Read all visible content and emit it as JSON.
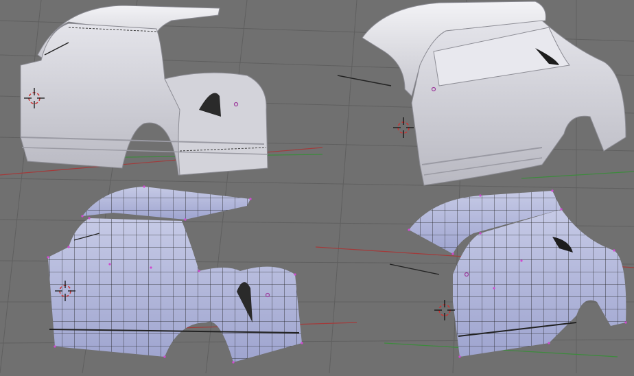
{
  "viewports": [
    {
      "id": "top-left",
      "view": "side-rear",
      "shading": "solid"
    },
    {
      "id": "top-right",
      "view": "front-three-quarter",
      "shading": "solid"
    },
    {
      "id": "bottom-left",
      "view": "side-rear",
      "shading": "wireframe-on-solid"
    },
    {
      "id": "bottom-right",
      "view": "front-three-quarter",
      "shading": "wireframe-on-solid"
    }
  ],
  "colors": {
    "background": "#707070",
    "grid_line": "#5f5f5f",
    "axis_x": "#a33a3a",
    "axis_y": "#3c8b3c",
    "body_solid": "#c9c9cf",
    "body_shadow": "#9a9aa3",
    "mesh_face": "#aeb3d6",
    "mesh_edge": "#1c1c1c",
    "vertex": "#d04ad0",
    "cursor": "#c33"
  },
  "icons": [
    "3d-cursor-icon",
    "object-origin-icon"
  ]
}
